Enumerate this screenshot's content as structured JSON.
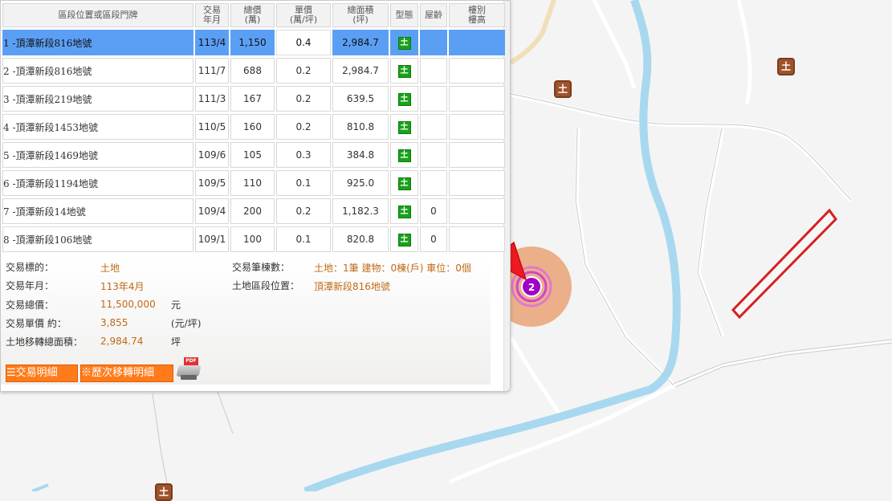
{
  "table": {
    "headers": {
      "address": "區段位置或區段門牌",
      "date": [
        "交易",
        "年月"
      ],
      "total": [
        "總價",
        "(萬)"
      ],
      "unit": [
        "單價",
        "(萬/坪)"
      ],
      "area": [
        "總面積",
        "(坪)"
      ],
      "type": "型態",
      "age": "屋齡",
      "floor": [
        "樓別",
        "樓高"
      ]
    },
    "rows": [
      {
        "address": "1 -頂潭新段816地號",
        "date": "113/4",
        "total": "1,150",
        "unit": "0.4",
        "area": "2,984.7",
        "type": "土",
        "age": "",
        "floor": ""
      },
      {
        "address": "2 -頂潭新段816地號",
        "date": "111/7",
        "total": "688",
        "unit": "0.2",
        "area": "2,984.7",
        "type": "土",
        "age": "",
        "floor": ""
      },
      {
        "address": "3 -頂潭新段219地號",
        "date": "111/3",
        "total": "167",
        "unit": "0.2",
        "area": "639.5",
        "type": "土",
        "age": "",
        "floor": ""
      },
      {
        "address": "4 -頂潭新段1453地號",
        "date": "110/5",
        "total": "160",
        "unit": "0.2",
        "area": "810.8",
        "type": "土",
        "age": "",
        "floor": ""
      },
      {
        "address": "5 -頂潭新段1469地號",
        "date": "109/6",
        "total": "105",
        "unit": "0.3",
        "area": "384.8",
        "type": "土",
        "age": "",
        "floor": ""
      },
      {
        "address": "6 -頂潭新段1194地號",
        "date": "109/5",
        "total": "110",
        "unit": "0.1",
        "area": "925.0",
        "type": "土",
        "age": "",
        "floor": ""
      },
      {
        "address": "7 -頂潭新段14地號",
        "date": "109/4",
        "total": "200",
        "unit": "0.2",
        "area": "1,182.3",
        "type": "土",
        "age": "0",
        "floor": ""
      },
      {
        "address": "8 -頂潭新段106地號",
        "date": "109/1",
        "total": "100",
        "unit": "0.1",
        "area": "820.8",
        "type": "土",
        "age": "0",
        "floor": ""
      }
    ]
  },
  "detail": {
    "target_label": "交易標的：",
    "target": "土地",
    "date_label": "交易年月：",
    "date": "113年4月",
    "total_label": "交易總價：",
    "total": "11,500,000",
    "total_unit": "元",
    "unit_label": "交易單價 約：",
    "unit": "3,855",
    "unit_unit": "(元/坪)",
    "area_label": "土地移轉總面積：",
    "area": "2,984.74",
    "area_unit": "坪",
    "count_label": "交易筆棟數：",
    "count": "土地：1筆 建物：0棟(戶) 車位：0個",
    "location_label": "土地區段位置：",
    "location": "頂潭新段816地號"
  },
  "buttons": {
    "detail": "☰交易明細",
    "history": "※歷次移轉明細",
    "pdf_badge": "PDF"
  },
  "map": {
    "cluster_count": "2",
    "land_icon": "土"
  },
  "colors": {
    "selected_row": "#5b9ff5",
    "accent": "#ff7b1a",
    "value_text": "#c06a15",
    "land_badge": "#17a317",
    "river": "#a8d8ef",
    "arrow": "#e8141b"
  }
}
